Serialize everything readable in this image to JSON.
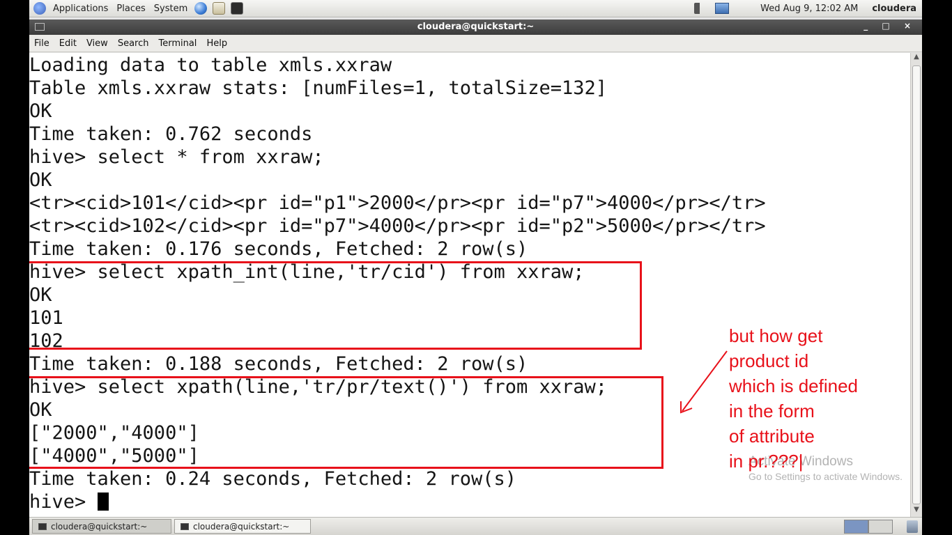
{
  "top_panel": {
    "menus": [
      "Applications",
      "Places",
      "System"
    ],
    "clock": "Wed Aug  9, 12:02 AM",
    "user": "cloudera"
  },
  "window": {
    "title": "cloudera@quickstart:~",
    "controls": "_ □ ×"
  },
  "menubar": [
    "File",
    "Edit",
    "View",
    "Search",
    "Terminal",
    "Help"
  ],
  "terminal": {
    "lines": [
      "Loading data to table xmls.xxraw",
      "Table xmls.xxraw stats: [numFiles=1, totalSize=132]",
      "OK",
      "Time taken: 0.762 seconds",
      "hive> select * from xxraw;",
      "OK",
      "<tr><cid>101</cid><pr id=\"p1\">2000</pr><pr id=\"p7\">4000</pr></tr>",
      "<tr><cid>102</cid><pr id=\"p7\">4000</pr><pr id=\"p2\">5000</pr></tr>",
      "Time taken: 0.176 seconds, Fetched: 2 row(s)",
      "hive> select xpath_int(line,'tr/cid') from xxraw;",
      "OK",
      "101",
      "102",
      "Time taken: 0.188 seconds, Fetched: 2 row(s)",
      "hive> select xpath(line,'tr/pr/text()') from xxraw;",
      "OK",
      "[\"2000\",\"4000\"]",
      "[\"4000\",\"5000\"]",
      "Time taken: 0.24 seconds, Fetched: 2 row(s)",
      "hive> "
    ]
  },
  "annotation": {
    "lines": [
      "but how get",
      "product id",
      "which is defined",
      "in the form",
      "of attribute",
      "in pr.???|"
    ],
    "color": "#e8111a"
  },
  "watermark": {
    "title": "Activate Windows",
    "subtitle": "Go to Settings to activate Windows."
  },
  "taskbar": {
    "tasks": [
      "cloudera@quickstart:~",
      "cloudera@quickstart:~"
    ]
  }
}
